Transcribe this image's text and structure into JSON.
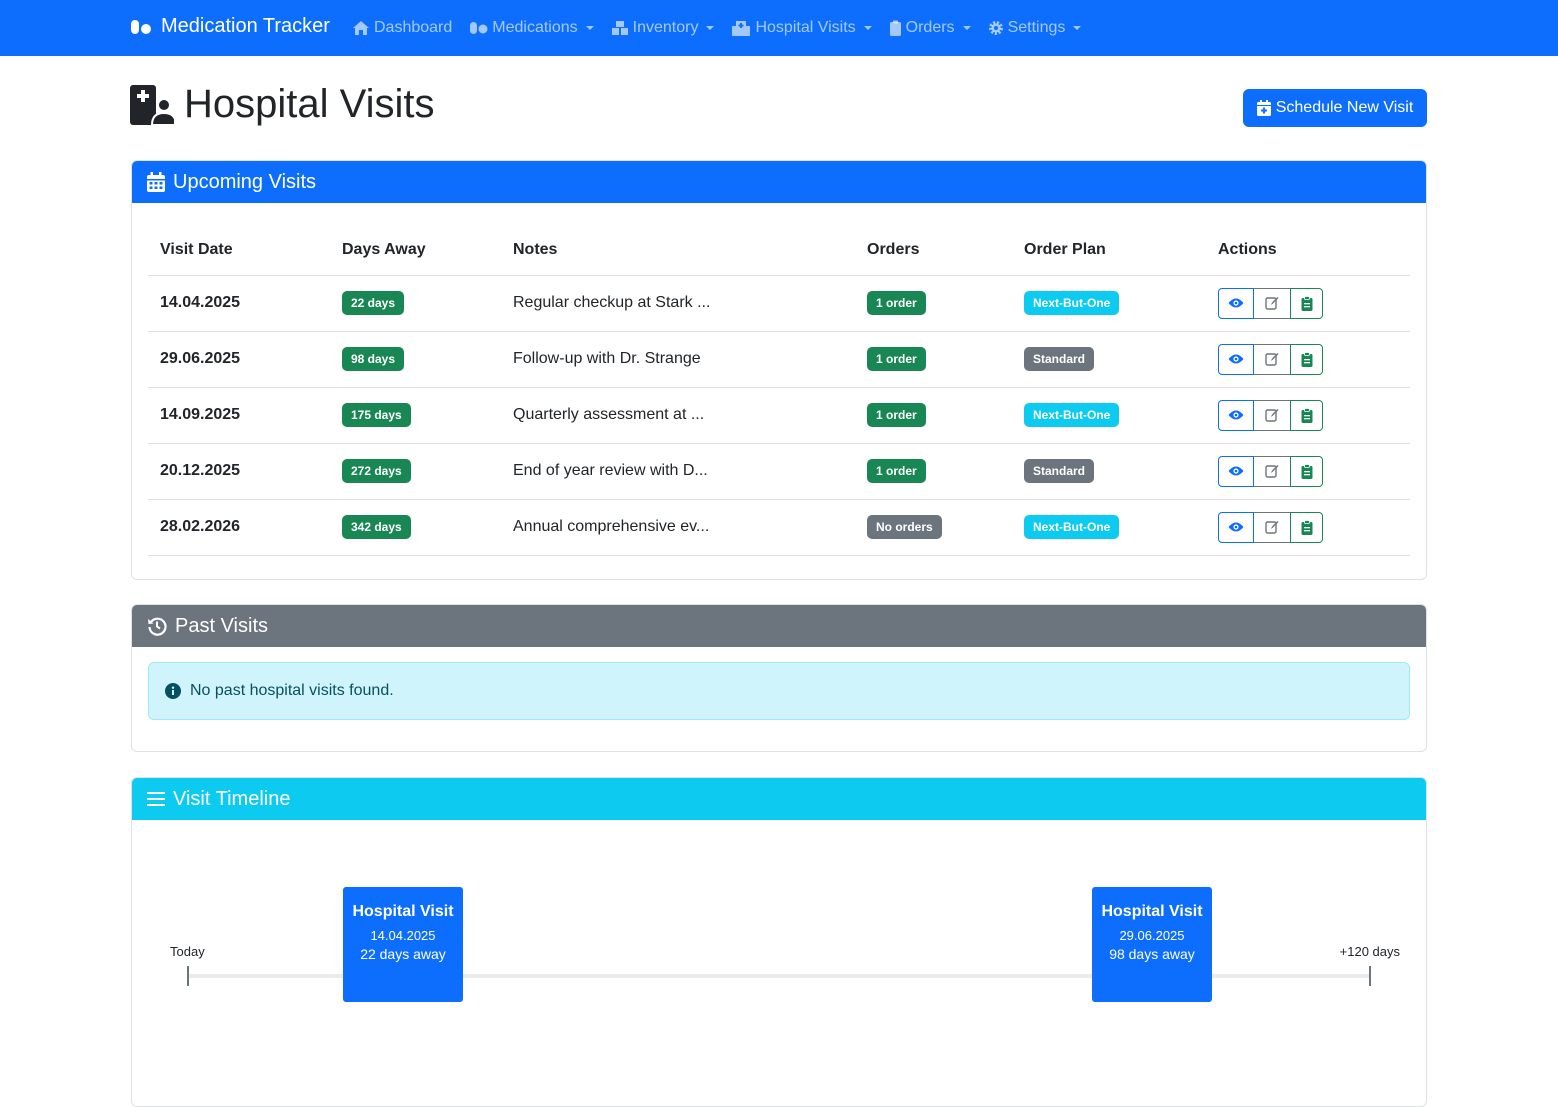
{
  "navbar": {
    "brand": "Medication Tracker",
    "items": [
      {
        "label": "Dashboard",
        "dropdown": false
      },
      {
        "label": "Medications",
        "dropdown": true
      },
      {
        "label": "Inventory",
        "dropdown": true
      },
      {
        "label": "Hospital Visits",
        "dropdown": true
      },
      {
        "label": "Orders",
        "dropdown": true
      },
      {
        "label": "Settings",
        "dropdown": true
      }
    ]
  },
  "page": {
    "title": "Hospital Visits",
    "schedule_button": "Schedule New Visit"
  },
  "upcoming": {
    "title": "Upcoming Visits",
    "columns": [
      "Visit Date",
      "Days Away",
      "Notes",
      "Orders",
      "Order Plan",
      "Actions"
    ],
    "rows": [
      {
        "date": "14.04.2025",
        "days": "22 days",
        "notes": "Regular checkup at Stark ...",
        "orders": "1 order",
        "orders_color": "#198754",
        "plan": "Next-But-One",
        "plan_color": "#0dcaf0"
      },
      {
        "date": "29.06.2025",
        "days": "98 days",
        "notes": "Follow-up with Dr. Strange",
        "orders": "1 order",
        "orders_color": "#198754",
        "plan": "Standard",
        "plan_color": "#6c757d"
      },
      {
        "date": "14.09.2025",
        "days": "175 days",
        "notes": "Quarterly assessment at ...",
        "orders": "1 order",
        "orders_color": "#198754",
        "plan": "Next-But-One",
        "plan_color": "#0dcaf0"
      },
      {
        "date": "20.12.2025",
        "days": "272 days",
        "notes": "End of year review with D...",
        "orders": "1 order",
        "orders_color": "#198754",
        "plan": "Standard",
        "plan_color": "#6c757d"
      },
      {
        "date": "28.02.2026",
        "days": "342 days",
        "notes": "Annual comprehensive ev...",
        "orders": "No orders",
        "orders_color": "#6c757d",
        "plan": "Next-But-One",
        "plan_color": "#0dcaf0"
      }
    ]
  },
  "past": {
    "title": "Past Visits",
    "empty_message": "No past hospital visits found."
  },
  "timeline": {
    "title": "Visit Timeline",
    "start_label": "Today",
    "end_label": "+120 days",
    "events": [
      {
        "title": "Hospital Visit",
        "date": "14.04.2025",
        "away": "22 days away"
      },
      {
        "title": "Hospital Visit",
        "date": "29.06.2025",
        "away": "98 days away"
      }
    ]
  },
  "colors": {
    "primary": "#0d6efd",
    "success": "#198754",
    "secondary": "#6c757d",
    "info": "#0dcaf0"
  }
}
